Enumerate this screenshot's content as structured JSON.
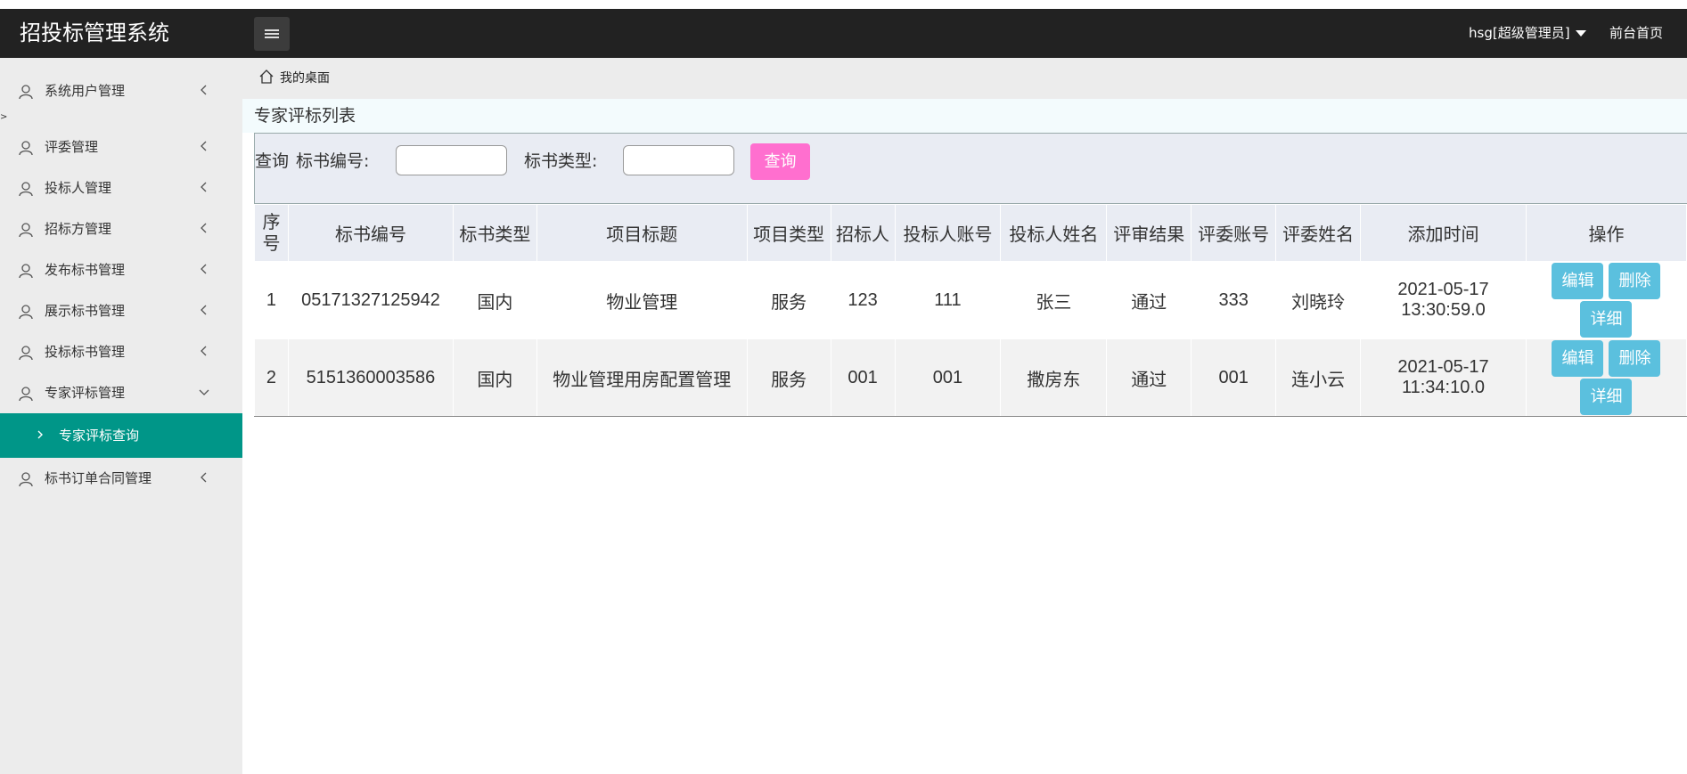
{
  "app": {
    "title": "招投标管理系统"
  },
  "header": {
    "user_label": "hsg[超级管理员]",
    "front_link": "前台首页"
  },
  "sidebar": {
    "items": [
      {
        "label": "系统用户管理"
      },
      {
        "label": "评委管理"
      },
      {
        "label": "投标人管理"
      },
      {
        "label": "招标方管理"
      },
      {
        "label": "发布标书管理"
      },
      {
        "label": "展示标书管理"
      },
      {
        "label": "投标标书管理"
      },
      {
        "label": "专家评标管理"
      },
      {
        "label": "标书订单合同管理"
      }
    ],
    "active_sub": {
      "label": "专家评标查询"
    },
    "stray_mark": ">"
  },
  "breadcrumb": {
    "label": "我的桌面"
  },
  "panel": {
    "title": "专家评标列表"
  },
  "search": {
    "prefix": "查询",
    "field1_label": "标书编号:",
    "field1_value": "",
    "field2_label": "标书类型:",
    "field2_value": "",
    "button_label": "查询"
  },
  "table": {
    "headers": [
      "序号",
      "标书编号",
      "标书类型",
      "项目标题",
      "项目类型",
      "招标人",
      "投标人账号",
      "投标人姓名",
      "评审结果",
      "评委账号",
      "评委姓名",
      "添加时间",
      "操作"
    ],
    "rows": [
      {
        "no": "1",
        "code": "05171327125942",
        "type": "国内",
        "title": "物业管理",
        "ptype": "服务",
        "tenderer": "123",
        "bidder_account": "111",
        "bidder_name": "张三",
        "result": "通过",
        "judge_account": "333",
        "judge_name": "刘晓玲",
        "date": "2021-05-17",
        "time": "13:30:59.0"
      },
      {
        "no": "2",
        "code": "5151360003586",
        "type": "国内",
        "title": "物业管理用房配置管理",
        "ptype": "服务",
        "tenderer": "001",
        "bidder_account": "001",
        "bidder_name": "撒房东",
        "result": "通过",
        "judge_account": "001",
        "judge_name": "连小云",
        "date": "2021-05-17",
        "time": "11:34:10.0"
      }
    ],
    "actions": {
      "edit": "编辑",
      "delete": "删除",
      "detail": "详细"
    }
  },
  "colors": {
    "header_bg": "#222222",
    "active_nav": "#009688",
    "search_button": "#ff6fcf",
    "action_button": "#5bc0de"
  }
}
